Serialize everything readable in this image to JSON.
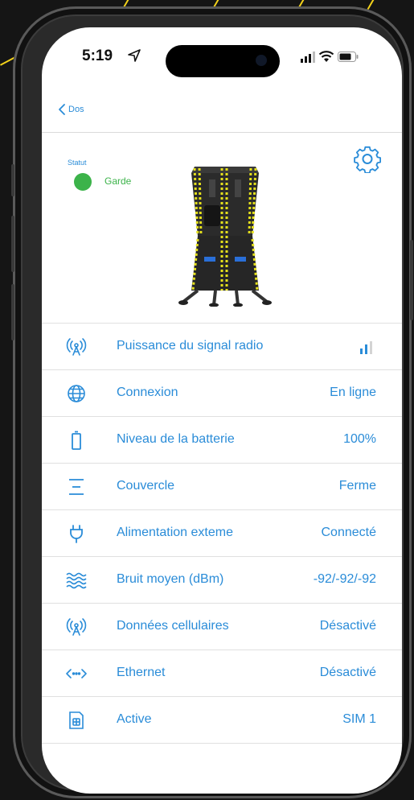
{
  "status_bar": {
    "time": "5:19"
  },
  "nav": {
    "back_label": "Dos"
  },
  "device": {
    "statut_label": "Statut",
    "status_text": "Garde",
    "status_color": "#3cb34a"
  },
  "accent_color": "#2a8cd8",
  "rows": [
    {
      "icon": "radio-tower-icon",
      "label": "Puissance du signal radio",
      "value": "",
      "signal_level": 2,
      "signal_max": 3
    },
    {
      "icon": "globe-icon",
      "label": "Connexion",
      "value": "En ligne"
    },
    {
      "icon": "battery-icon",
      "label": "Niveau de la batterie",
      "value": "100%"
    },
    {
      "icon": "lid-icon",
      "label": "Couvercle",
      "value": "Ferme"
    },
    {
      "icon": "plug-icon",
      "label": "Alimentation exteme",
      "value": "Connecté"
    },
    {
      "icon": "waves-icon",
      "label": "Bruit moyen (dBm)",
      "value": "-92/-92/-92"
    },
    {
      "icon": "radio-tower-icon",
      "label": "Données cellulaires",
      "value": "Désactivé"
    },
    {
      "icon": "ethernet-icon",
      "label": "Ethernet",
      "value": "Désactivé"
    },
    {
      "icon": "sim-card-icon",
      "label": "Active",
      "value": "SIM 1"
    }
  ]
}
